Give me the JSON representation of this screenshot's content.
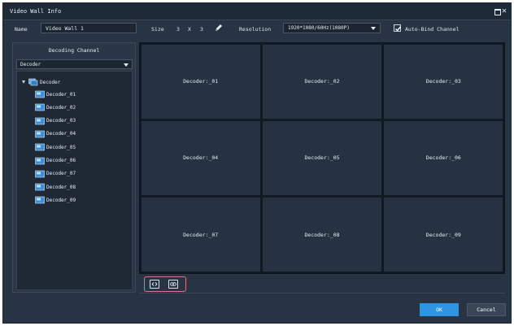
{
  "window": {
    "title": "Video Wall  Info"
  },
  "form": {
    "name_label": "Name",
    "name_value": "Video Wall 1",
    "size_label": "Size",
    "size_rows": "3",
    "size_x": "X",
    "size_cols": "3",
    "resolution_label": "Resolution",
    "resolution_value": "1920*1080/60Hz(1080P)",
    "auto_bind_label": "Auto-Bind Channel",
    "auto_bind_checked": true
  },
  "left_panel": {
    "header": "Decoding Channel",
    "selector_value": "Decoder",
    "tree": {
      "root": "Decoder",
      "children": [
        "Decoder_01",
        "Decoder_02",
        "Decoder_03",
        "Decoder_04",
        "Decoder_05",
        "Decoder_06",
        "Decoder_07",
        "Decoder_08",
        "Decoder_09"
      ]
    }
  },
  "wall": {
    "cells": [
      "Decoder:_01",
      "Decoder:_02",
      "Decoder:_03",
      "Decoder:_04",
      "Decoder:_05",
      "Decoder:_06",
      "Decoder:_07",
      "Decoder:_08",
      "Decoder:_09"
    ]
  },
  "buttons": {
    "ok": "OK",
    "cancel": "Cancel"
  },
  "icons": {
    "window_controls": [
      "restore-icon",
      "close-icon"
    ],
    "toolbar": [
      "pencil-icon"
    ],
    "bottom": [
      "split-screen-icon",
      "unbind-icon"
    ],
    "tree": [
      "decoder-group-icon",
      "decoder-device-icon"
    ]
  },
  "colors": {
    "background": "#283443",
    "cell": "#263241",
    "grid_lines": "#111922",
    "accent": "#2e95e2",
    "highlight": "#d27a88"
  }
}
